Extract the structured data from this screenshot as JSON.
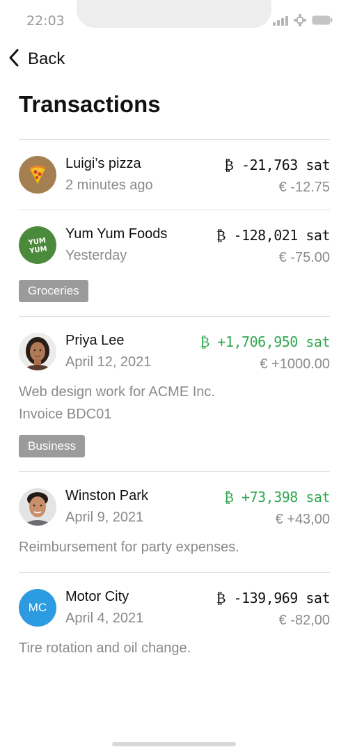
{
  "status_bar": {
    "time": "22:03"
  },
  "nav": {
    "back_label": "Back"
  },
  "page_title": "Transactions",
  "transactions": [
    {
      "name": "Luigi’s pizza",
      "time": "2 minutes ago",
      "sat": "₿ -21,763 sat",
      "fiat": "€ -12.75",
      "direction": "negative",
      "avatar_icon": "pizza-icon",
      "avatar_color": "#a47f51"
    },
    {
      "name": "Yum Yum Foods",
      "time": "Yesterday",
      "sat": "₿ -128,021 sat",
      "fiat": "€ -75.00",
      "direction": "negative",
      "avatar_icon": "yum-yum-logo",
      "avatar_text": "YUM YUM",
      "avatar_color": "#4c8a3b",
      "tag": "Groceries"
    },
    {
      "name": "Priya Lee",
      "time": "April 12, 2021",
      "sat": "₿ +1,706,950 sat",
      "fiat": "€ +1000.00",
      "direction": "positive",
      "avatar_icon": "person-photo",
      "note_lines": [
        "Web design work for ACME Inc.",
        "Invoice BDC01"
      ],
      "tag": "Business"
    },
    {
      "name": "Winston Park",
      "time": "April 9, 2021",
      "sat": "₿ +73,398 sat",
      "fiat": "€ +43,00",
      "direction": "positive",
      "avatar_icon": "person-photo",
      "note_lines": [
        "Reimbursement for party expenses."
      ]
    },
    {
      "name": "Motor City",
      "time": "April 4, 2021",
      "sat": "₿ -139,969 sat",
      "fiat": "€ -82,00",
      "direction": "negative",
      "avatar_icon": "initials-avatar",
      "avatar_text": "MC",
      "avatar_color": "#2d9be0",
      "note_lines": [
        "Tire rotation and oil change."
      ]
    }
  ],
  "colors": {
    "positive": "#2fa84f",
    "tag_bg": "#9b9b9b",
    "muted_text": "#8a8a8a"
  }
}
